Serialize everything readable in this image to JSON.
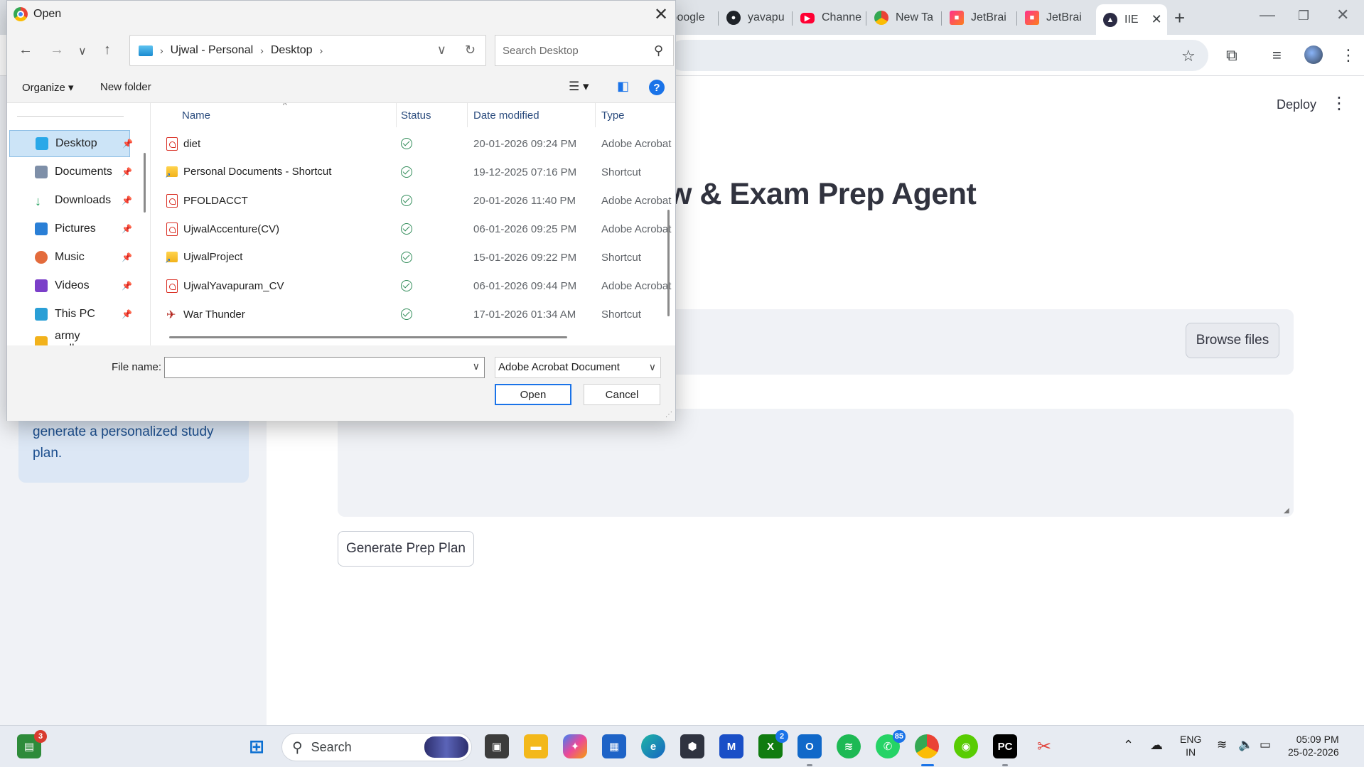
{
  "browser": {
    "tabs": [
      {
        "label": "Google",
        "icon": "google-icon"
      },
      {
        "label": "yavapu",
        "icon": "github-icon"
      },
      {
        "label": "Channe",
        "icon": "youtube-icon"
      },
      {
        "label": "New Ta",
        "icon": "chrome-icon"
      },
      {
        "label": "JetBrai",
        "icon": "jetbrains-icon"
      },
      {
        "label": "JetBrai",
        "icon": "jetbrains-icon"
      },
      {
        "label": "IIE",
        "icon": "graduation-cap-icon",
        "active": true
      }
    ],
    "new_tab": "+",
    "close_tab": "✕"
  },
  "app": {
    "deploy_label": "Deploy",
    "title_visible": "w & Exam Prep Agent",
    "browse_label": "Browse files",
    "generate_label": "Generate Prep Plan",
    "sidebar_text": "generate a personalized study plan."
  },
  "dialog": {
    "title": "Open",
    "breadcrumb": [
      "Ujwal - Personal",
      "Desktop"
    ],
    "search_placeholder": "Search Desktop",
    "organize": "Organize",
    "new_folder": "New folder",
    "help": "?",
    "nav_items": [
      {
        "label": "Desktop",
        "icon": "desktop-icon",
        "color": "#29a8e8",
        "selected": true
      },
      {
        "label": "Documents",
        "icon": "documents-icon",
        "color": "#7e8fa8"
      },
      {
        "label": "Downloads",
        "icon": "downloads-icon",
        "color": "#1e9e5a"
      },
      {
        "label": "Pictures",
        "icon": "pictures-icon",
        "color": "#2a7fd6"
      },
      {
        "label": "Music",
        "icon": "music-icon",
        "color": "#e36b3c"
      },
      {
        "label": "Videos",
        "icon": "videos-icon",
        "color": "#7b3fc9"
      },
      {
        "label": "This PC",
        "icon": "this-pc-icon",
        "color": "#2a9fd6"
      },
      {
        "label": "army wallpapers",
        "icon": "folder-icon",
        "color": "#f2b21b"
      }
    ],
    "columns": [
      "Name",
      "Status",
      "Date modified",
      "Type"
    ],
    "files": [
      {
        "name": "diet",
        "icon": "pdf",
        "date": "20-01-2026 09:24 PM",
        "type": "Adobe Acrobat"
      },
      {
        "name": "Personal Documents - Shortcut",
        "icon": "folder",
        "date": "19-12-2025 07:16 PM",
        "type": "Shortcut"
      },
      {
        "name": "PFOLDACCT",
        "icon": "pdf",
        "date": "20-01-2026 11:40 PM",
        "type": "Adobe Acrobat"
      },
      {
        "name": "UjwalAccenture(CV)",
        "icon": "pdf",
        "date": "06-01-2026 09:25 PM",
        "type": "Adobe Acrobat"
      },
      {
        "name": "UjwalProject",
        "icon": "folder",
        "date": "15-01-2026 09:22 PM",
        "type": "Shortcut"
      },
      {
        "name": "UjwalYavapuram_CV",
        "icon": "pdf",
        "date": "06-01-2026 09:44 PM",
        "type": "Adobe Acrobat"
      },
      {
        "name": "War Thunder",
        "icon": "game",
        "date": "17-01-2026 01:34 AM",
        "type": "Shortcut"
      }
    ],
    "file_name_label": "File name:",
    "file_name_value": "",
    "file_type": "Adobe Acrobat Document",
    "open_label": "Open",
    "cancel_label": "Cancel"
  },
  "taskbar": {
    "search_label": "Search",
    "store_badge": "3",
    "xbox_badge": "2",
    "whatsapp_badge": "85",
    "lang_top": "ENG",
    "lang_bottom": "IN",
    "time": "05:09 PM",
    "date": "25-02-2026"
  },
  "colors": {
    "accent": "#1a73e8",
    "check_green": "#2e8b57",
    "pdf_red": "#d93025"
  }
}
